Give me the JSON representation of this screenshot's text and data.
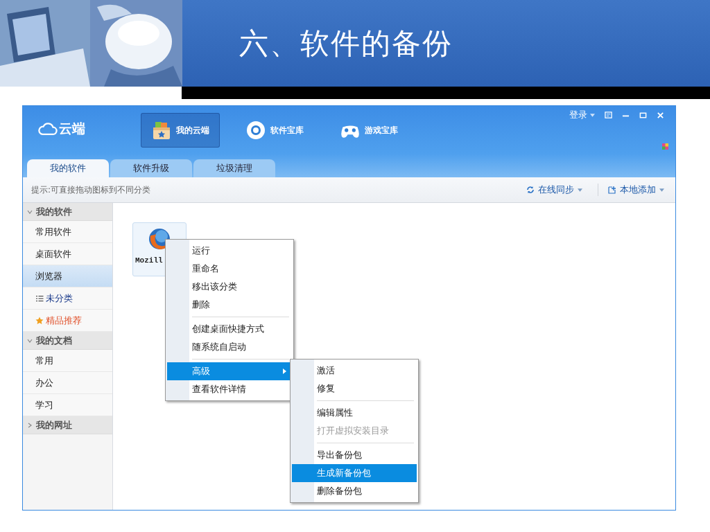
{
  "slide": {
    "title": "六、软件的备份"
  },
  "window": {
    "logo": "云端",
    "login": "登录",
    "nav": [
      {
        "label": "我的云端",
        "selected": true,
        "kind": "box"
      },
      {
        "label": "软件宝库",
        "selected": false,
        "kind": "disc"
      },
      {
        "label": "游戏宝库",
        "selected": false,
        "kind": "gamepad"
      }
    ]
  },
  "tabs": [
    {
      "label": "我的软件",
      "selected": true
    },
    {
      "label": "软件升级",
      "selected": false
    },
    {
      "label": "垃圾清理",
      "selected": false
    }
  ],
  "hint": "提示:可直接拖动图标到不同分类",
  "toolbar": [
    {
      "label": "在线同步",
      "kind": "sync"
    },
    {
      "label": "本地添加",
      "kind": "add"
    }
  ],
  "sidebar": [
    {
      "label": "我的软件",
      "expanded": true,
      "children": [
        {
          "label": "常用软件",
          "selected": false,
          "kind": "plain"
        },
        {
          "label": "桌面软件",
          "selected": false,
          "kind": "plain"
        },
        {
          "label": "浏览器",
          "selected": true,
          "kind": "plain"
        },
        {
          "label": "未分类",
          "selected": false,
          "kind": "list"
        },
        {
          "label": "精品推荐",
          "selected": false,
          "kind": "star"
        }
      ]
    },
    {
      "label": "我的文档",
      "expanded": true,
      "children": [
        {
          "label": "常用",
          "selected": false,
          "kind": "plain"
        },
        {
          "label": "办公",
          "selected": false,
          "kind": "plain"
        },
        {
          "label": "学习",
          "selected": false,
          "kind": "plain"
        }
      ]
    },
    {
      "label": "我的网址",
      "expanded": false
    }
  ],
  "apps": [
    {
      "name": "Mozill",
      "kind": "globe"
    }
  ],
  "context_menu": [
    [
      {
        "label": "运行",
        "selected": false,
        "disabled": false,
        "submenu": false
      },
      {
        "label": "重命名",
        "selected": false,
        "disabled": false,
        "submenu": false
      },
      {
        "label": "移出该分类",
        "selected": false,
        "disabled": false,
        "submenu": false
      },
      {
        "label": "删除",
        "selected": false,
        "disabled": false,
        "submenu": false
      }
    ],
    [
      {
        "label": "创建桌面快捷方式",
        "selected": false,
        "disabled": false,
        "submenu": false
      },
      {
        "label": "随系统自启动",
        "selected": false,
        "disabled": false,
        "submenu": false
      }
    ],
    [
      {
        "label": "高级",
        "selected": true,
        "disabled": false,
        "submenu": true
      },
      {
        "label": "查看软件详情",
        "selected": false,
        "disabled": false,
        "submenu": false
      }
    ]
  ],
  "submenu": [
    [
      {
        "label": "激活",
        "selected": false,
        "disabled": false,
        "submenu": false
      },
      {
        "label": "修复",
        "selected": false,
        "disabled": false,
        "submenu": false
      }
    ],
    [
      {
        "label": "编辑属性",
        "selected": false,
        "disabled": false,
        "submenu": false
      },
      {
        "label": "打开虚拟安装目录",
        "selected": false,
        "disabled": true,
        "submenu": false
      }
    ],
    [
      {
        "label": "导出备份包",
        "selected": false,
        "disabled": false,
        "submenu": false
      },
      {
        "label": "生成新备份包",
        "selected": true,
        "disabled": false,
        "submenu": false
      },
      {
        "label": "删除备份包",
        "selected": false,
        "disabled": false,
        "submenu": false
      }
    ]
  ]
}
